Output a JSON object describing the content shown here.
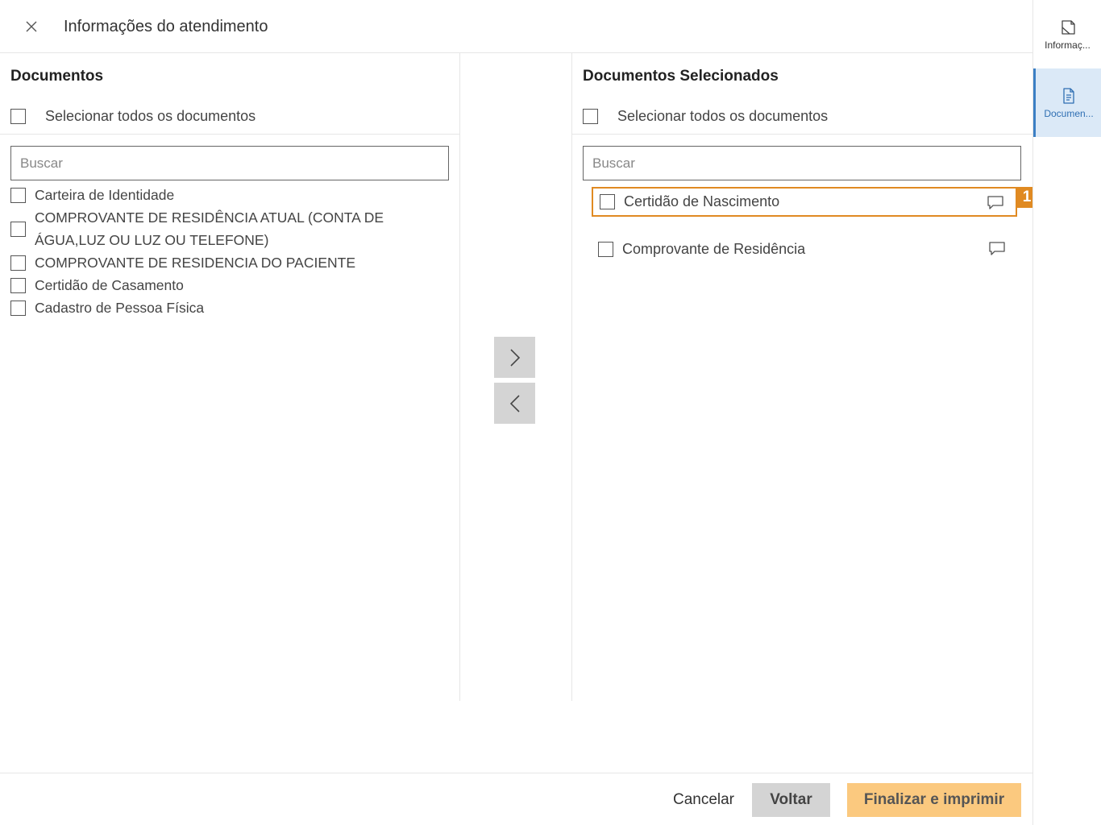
{
  "header": {
    "title": "Informações do atendimento"
  },
  "left": {
    "title": "Documentos",
    "select_all_label": "Selecionar todos os documentos",
    "search_placeholder": "Buscar",
    "items": [
      {
        "label": "Carteira de Identidade"
      },
      {
        "label": "COMPROVANTE DE RESIDÊNCIA ATUAL (CONTA DE",
        "label2": "ÁGUA,LUZ OU LUZ OU TELEFONE)"
      },
      {
        "label": "COMPROVANTE DE RESIDENCIA DO PACIENTE"
      },
      {
        "label": "Certidão de Casamento"
      },
      {
        "label": "Cadastro de Pessoa Física"
      }
    ]
  },
  "right": {
    "title": "Documentos Selecionados",
    "select_all_label": "Selecionar todos os documentos",
    "search_placeholder": "Buscar",
    "items": [
      {
        "label": "Certidão de Nascimento",
        "badge": "1"
      },
      {
        "label": "Comprovante de Residência"
      }
    ]
  },
  "footer": {
    "cancel_label": "Cancelar",
    "back_label": "Voltar",
    "finish_label": "Finalizar e imprimir"
  },
  "sidebar": {
    "items": [
      {
        "label": "Informaç...",
        "icon": "info-document-icon"
      },
      {
        "label": "Documen...",
        "icon": "document-icon",
        "active": true
      }
    ]
  },
  "colors": {
    "accent": "#e08a22",
    "primary_button": "#fbc97f",
    "active_nav": "#dbe9f7",
    "active_nav_border": "#3b7fc4"
  }
}
